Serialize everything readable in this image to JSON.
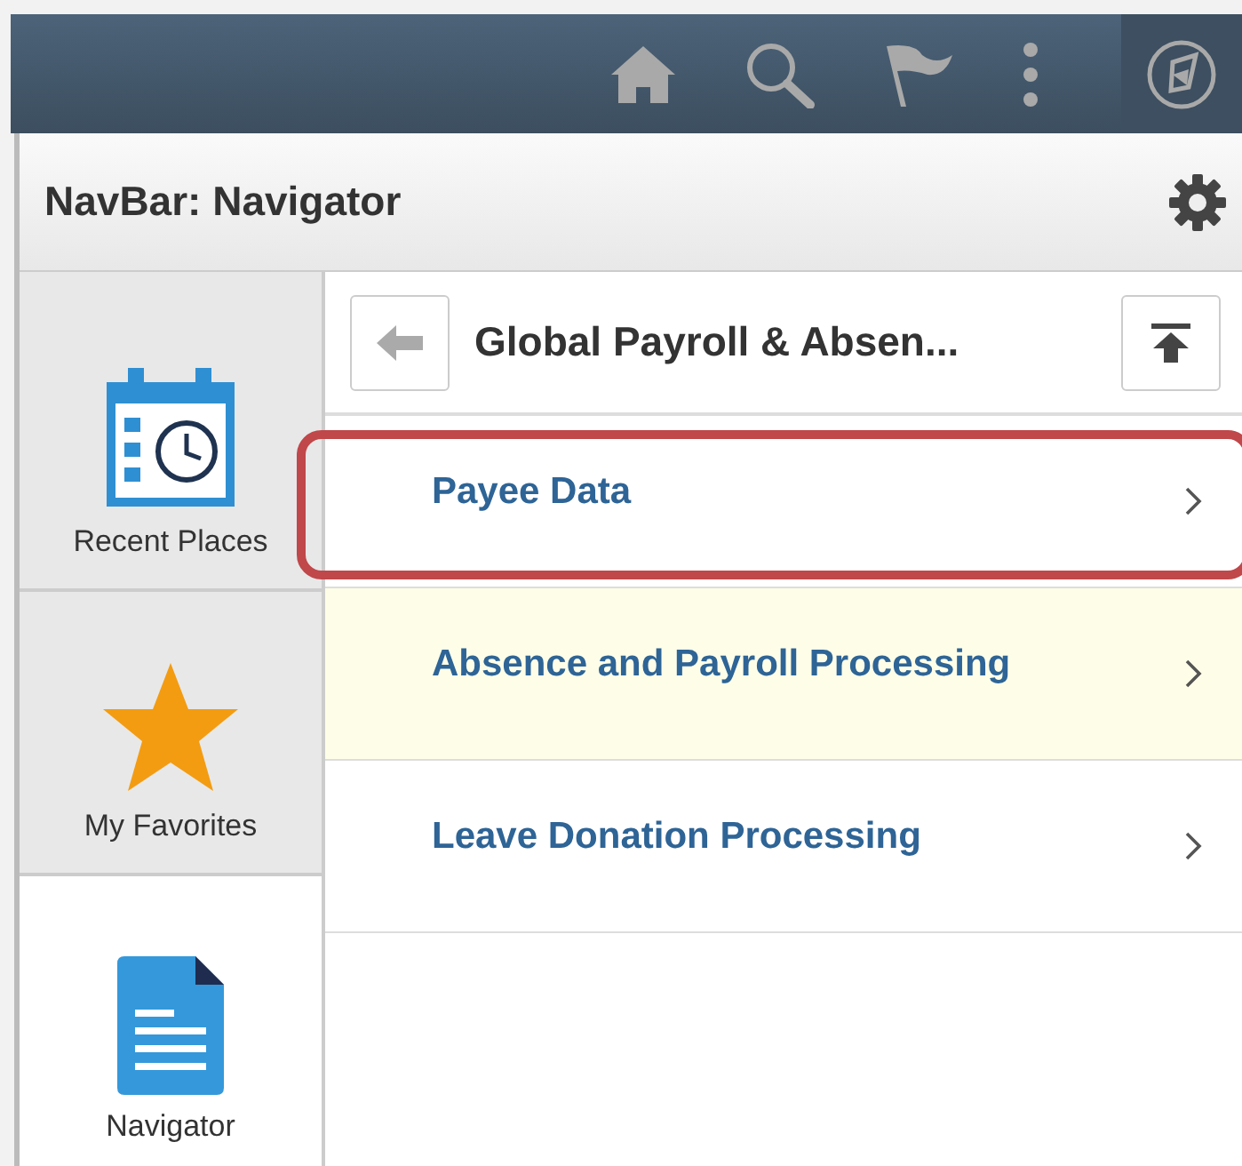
{
  "title": "NavBar: Navigator",
  "sidebar": [
    {
      "kind": "recent",
      "label": "Recent Places",
      "selected": false
    },
    {
      "kind": "favorites",
      "label": "My Favorites",
      "selected": false
    },
    {
      "kind": "navigator",
      "label": "Navigator",
      "selected": true
    }
  ],
  "breadcrumb": "Global Payroll & Absen...",
  "items": [
    {
      "label": "Payee Data",
      "highlighted": true,
      "hovered": false
    },
    {
      "label": "Absence and Payroll Processing",
      "highlighted": false,
      "hovered": true
    },
    {
      "label": "Leave Donation Processing",
      "highlighted": false,
      "hovered": false
    }
  ]
}
